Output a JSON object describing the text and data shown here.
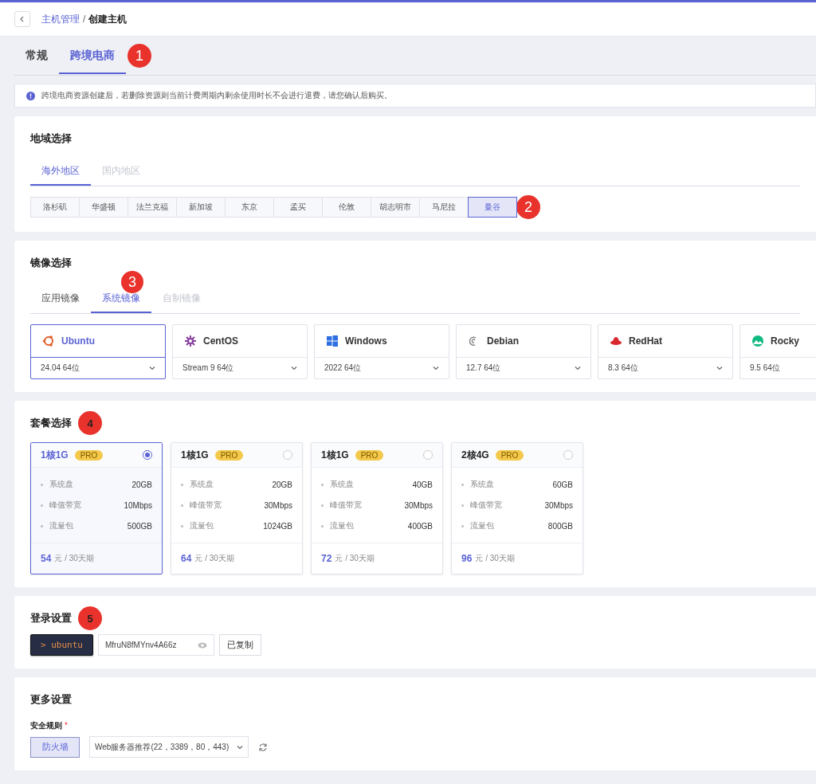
{
  "breadcrumb": {
    "parent": "主机管理",
    "separator": "/",
    "current": "创建主机"
  },
  "tabs": [
    {
      "label": "常规",
      "selected": false
    },
    {
      "label": "跨境电商",
      "selected": true
    }
  ],
  "tabs_marker": "1",
  "notice": "跨境电商资源创建后，若删除资源则当前计费周期内剩余使用时长不会进行退费，请您确认后购买。",
  "region": {
    "title": "地域选择",
    "marker": "2",
    "tabs": [
      {
        "label": "海外地区",
        "selected": true,
        "disabled": false
      },
      {
        "label": "国内地区",
        "selected": false,
        "disabled": true
      }
    ],
    "cities": [
      {
        "label": "洛杉矶",
        "selected": false
      },
      {
        "label": "华盛顿",
        "selected": false
      },
      {
        "label": "法兰克福",
        "selected": false
      },
      {
        "label": "新加坡",
        "selected": false
      },
      {
        "label": "东京",
        "selected": false
      },
      {
        "label": "孟买",
        "selected": false
      },
      {
        "label": "伦敦",
        "selected": false
      },
      {
        "label": "胡志明市",
        "selected": false
      },
      {
        "label": "马尼拉",
        "selected": false
      },
      {
        "label": "曼谷",
        "selected": true
      }
    ]
  },
  "image": {
    "title": "镜像选择",
    "marker": "3",
    "tabs": [
      {
        "label": "应用镜像",
        "selected": false,
        "disabled": false
      },
      {
        "label": "系统镜像",
        "selected": true,
        "disabled": false
      },
      {
        "label": "自制镜像",
        "selected": false,
        "disabled": true
      }
    ],
    "os": [
      {
        "kind": "ubuntu",
        "name": "Ubuntu",
        "version": "24.04 64位",
        "selected": true
      },
      {
        "kind": "centos",
        "name": "CentOS",
        "version": "Stream 9 64位",
        "selected": false
      },
      {
        "kind": "windows",
        "name": "Windows",
        "version": "2022 64位",
        "selected": false
      },
      {
        "kind": "debian",
        "name": "Debian",
        "version": "12.7 64位",
        "selected": false
      },
      {
        "kind": "redhat",
        "name": "RedHat",
        "version": "8.3 64位",
        "selected": false
      },
      {
        "kind": "rocky",
        "name": "Rocky",
        "version": "9.5 64位",
        "selected": false
      }
    ]
  },
  "plans": {
    "title": "套餐选择",
    "marker": "4",
    "items": [
      {
        "name": "1核1G",
        "badge": "PRO",
        "selected": true,
        "specs": [
          {
            "label": "系统盘",
            "value": "20GB"
          },
          {
            "label": "峰值带宽",
            "value": "10Mbps"
          },
          {
            "label": "流量包",
            "value": "500GB"
          }
        ],
        "price": "54",
        "unit": "元 / 30天期"
      },
      {
        "name": "1核1G",
        "badge": "PRO",
        "selected": false,
        "specs": [
          {
            "label": "系统盘",
            "value": "20GB"
          },
          {
            "label": "峰值带宽",
            "value": "30Mbps"
          },
          {
            "label": "流量包",
            "value": "1024GB"
          }
        ],
        "price": "64",
        "unit": "元 / 30天期"
      },
      {
        "name": "1核1G",
        "badge": "PRO",
        "selected": false,
        "specs": [
          {
            "label": "系统盘",
            "value": "40GB"
          },
          {
            "label": "峰值带宽",
            "value": "30Mbps"
          },
          {
            "label": "流量包",
            "value": "400GB"
          }
        ],
        "price": "72",
        "unit": "元 / 30天期"
      },
      {
        "name": "2核4G",
        "badge": "PRO",
        "selected": false,
        "specs": [
          {
            "label": "系统盘",
            "value": "60GB"
          },
          {
            "label": "峰值带宽",
            "value": "30Mbps"
          },
          {
            "label": "流量包",
            "value": "800GB"
          }
        ],
        "price": "96",
        "unit": "元 / 30天期"
      }
    ]
  },
  "login": {
    "title": "登录设置",
    "marker": "5",
    "user": "> ubuntu",
    "password": "MfruN8fMYnv4A66z",
    "copy": "已复制"
  },
  "more": {
    "title": "更多设置",
    "rule_label": "安全规则",
    "required": "*",
    "firewall": "防火墙",
    "rule": "Web服务器推荐(22，3389，80，443)"
  }
}
